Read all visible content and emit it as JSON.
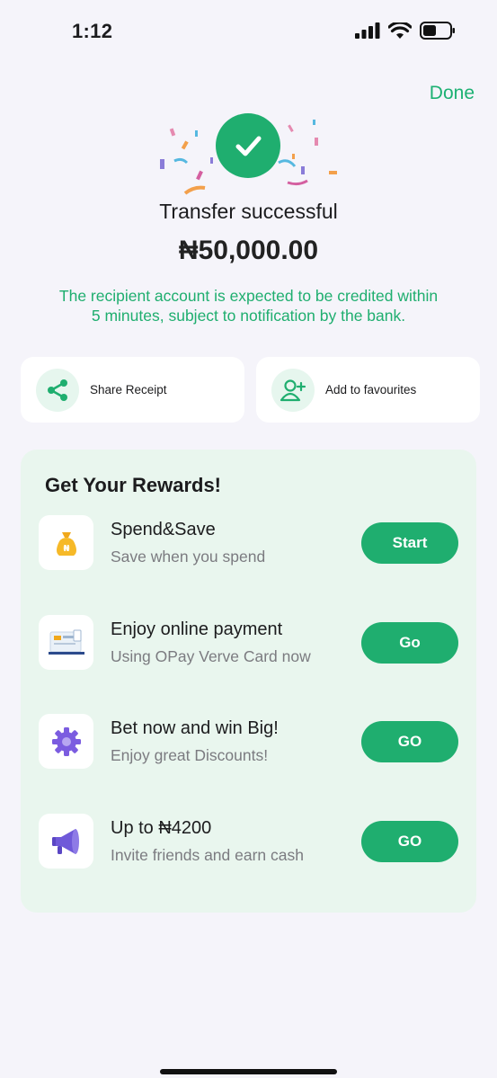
{
  "status_bar": {
    "time": "1:12"
  },
  "header": {
    "done_label": "Done"
  },
  "result": {
    "title": "Transfer successful",
    "amount": "₦50,000.00",
    "notice": "The recipient account is expected to be credited within 5 minutes, subject to notification by the bank."
  },
  "actions": [
    {
      "label": "Share Receipt",
      "icon": "share-icon"
    },
    {
      "label": "Add to favourites",
      "icon": "add-user-icon"
    }
  ],
  "rewards": {
    "title": "Get Your Rewards!",
    "items": [
      {
        "title": "Spend&Save",
        "subtitle": "Save when you spend",
        "button": "Start",
        "icon": "money-bag-icon"
      },
      {
        "title": "Enjoy online payment",
        "subtitle": "Using OPay Verve Card now",
        "button": "Go",
        "icon": "online-payment-icon"
      },
      {
        "title": "Bet now and win Big!",
        "subtitle": "Enjoy great Discounts!",
        "button": "GO",
        "icon": "gear-badge-icon"
      },
      {
        "title": "Up to ₦4200",
        "subtitle": "Invite friends and earn cash",
        "button": "GO",
        "icon": "megaphone-icon"
      }
    ]
  },
  "colors": {
    "accent": "#1fae6f",
    "rewards_bg": "#e9f6ee",
    "page_bg": "#f5f4fa"
  }
}
